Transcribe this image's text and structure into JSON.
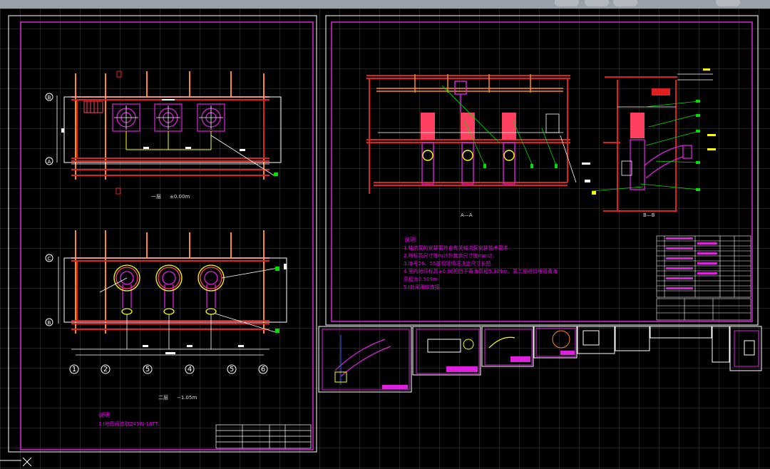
{
  "window": {
    "title_bar_color": "#9aa0a8",
    "canvas_bg": "#000000"
  },
  "colors": {
    "frame": "#e020e0",
    "wall": "#e02020",
    "wall_fill": "#ff8c1a",
    "pipe": "#e020e0",
    "equipment": "#ff4060",
    "dim": "#ffff00",
    "leader": "#00e000",
    "white": "#ffffff"
  },
  "sheet1": {
    "plan1_caption": "一层",
    "plan1_level": "±0.00m",
    "plan2_caption": "二层",
    "plan2_level": "−1.05m",
    "grid_labels_top": [
      "B",
      "A"
    ],
    "grid_labels_bottom": [
      "C",
      "B"
    ],
    "axis_numbers": [
      "1",
      "2",
      "5",
      "4",
      "5",
      "6"
    ],
    "notes_title": "说明",
    "notes": [
      "1.Ⅰ地图阀选取Z45W-16TT."
    ]
  },
  "sheet2": {
    "section_a_caption": "A—A",
    "section_b_caption": "B—B",
    "notes_title": "说明",
    "notes": [
      "1.轴流泵的安装要符合有关轴流泵安装技术要求.",
      "2.除标高尺寸按m计外其余尺寸按mm计.",
      "3.序号26、55按现场情况决定尺寸长短.",
      "4.室内地坪标高±0.00相当于黄海高程5.309m，泵二轴进口埋管黄海",
      "高程为2.509m",
      "5.Ⅰ处采用软连接."
    ]
  },
  "ucs_icon": "ucs-x-axis-icon",
  "ucs_label": "X"
}
